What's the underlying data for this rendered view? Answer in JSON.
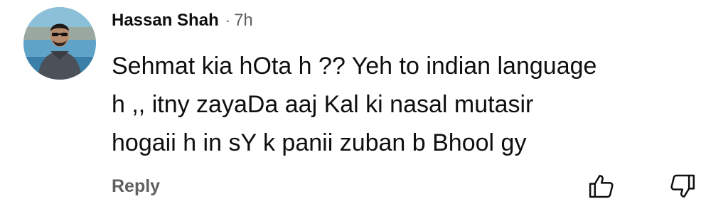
{
  "comment": {
    "author": "Hassan Shah",
    "separator": "·",
    "time": "7h",
    "lines": [
      "Sehmat kia hOta h ?? Yeh to indian language",
      "h ,, itny zayaDa aaj Kal ki nasal mutasir",
      "hogaii h in sY k panii zuban b Bhool gy"
    ],
    "reply_label": "Reply",
    "icons": {
      "like": "thumbs-up-icon",
      "dislike": "thumbs-down-icon",
      "avatar": "user-avatar-photo"
    }
  }
}
